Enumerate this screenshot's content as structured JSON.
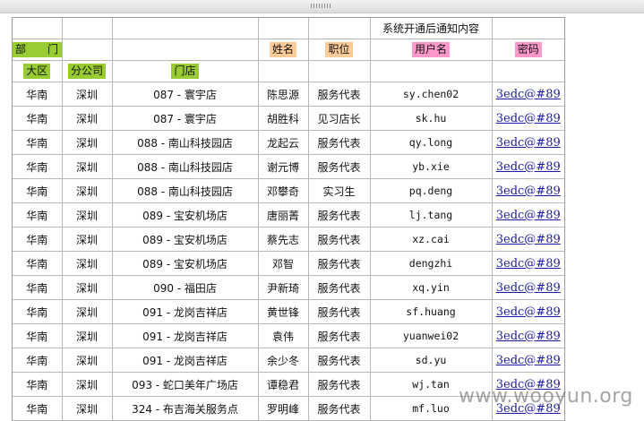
{
  "header": {
    "notify_title": "系统开通后通知内容",
    "dept": "部　门",
    "name": "姓名",
    "position": "职位",
    "username": "用户名",
    "password": "密码",
    "region": "大区",
    "branch": "分公司",
    "store": "门店"
  },
  "colors": {
    "green_highlight": "#99cc33",
    "orange_highlight": "#ffcc99",
    "pink_highlight": "#ff99cc",
    "link": "#1a1aa6"
  },
  "rows": [
    {
      "region": "华南",
      "branch": "深圳",
      "store": "087 - 寰宇店",
      "name": "陈思源",
      "position": "服务代表",
      "username": "sy.chen02",
      "password": "3edc@#89"
    },
    {
      "region": "华南",
      "branch": "深圳",
      "store": "087 - 寰宇店",
      "name": "胡胜科",
      "position": "见习店长",
      "username": "sk.hu",
      "password": "3edc@#89"
    },
    {
      "region": "华南",
      "branch": "深圳",
      "store": "088 - 南山科技园店",
      "name": "龙起云",
      "position": "服务代表",
      "username": "qy.long",
      "password": "3edc@#89"
    },
    {
      "region": "华南",
      "branch": "深圳",
      "store": "088 - 南山科技园店",
      "name": "谢元博",
      "position": "服务代表",
      "username": "yb.xie",
      "password": "3edc@#89"
    },
    {
      "region": "华南",
      "branch": "深圳",
      "store": "088 - 南山科技园店",
      "name": "邓攀奇",
      "position": "实习生",
      "username": "pq.deng",
      "password": "3edc@#89"
    },
    {
      "region": "华南",
      "branch": "深圳",
      "store": "089 - 宝安机场店",
      "name": "唐丽菁",
      "position": "服务代表",
      "username": "lj.tang",
      "password": "3edc@#89"
    },
    {
      "region": "华南",
      "branch": "深圳",
      "store": "089 - 宝安机场店",
      "name": "蔡先志",
      "position": "服务代表",
      "username": "xz.cai",
      "password": "3edc@#89"
    },
    {
      "region": "华南",
      "branch": "深圳",
      "store": "089 - 宝安机场店",
      "name": "邓智",
      "position": "服务代表",
      "username": "dengzhi",
      "password": "3edc@#89"
    },
    {
      "region": "华南",
      "branch": "深圳",
      "store": "090 - 福田店",
      "name": "尹新琦",
      "position": "服务代表",
      "username": "xq.yin",
      "password": "3edc@#89"
    },
    {
      "region": "华南",
      "branch": "深圳",
      "store": "091 - 龙岗吉祥店",
      "name": "黄世锋",
      "position": "服务代表",
      "username": "sf.huang",
      "password": "3edc@#89"
    },
    {
      "region": "华南",
      "branch": "深圳",
      "store": "091 - 龙岗吉祥店",
      "name": "袁伟",
      "position": "服务代表",
      "username": "yuanwei02",
      "password": "3edc@#89"
    },
    {
      "region": "华南",
      "branch": "深圳",
      "store": "091 - 龙岗吉祥店",
      "name": "余少冬",
      "position": "服务代表",
      "username": "sd.yu",
      "password": "3edc@#89"
    },
    {
      "region": "华南",
      "branch": "深圳",
      "store": "093 - 蛇口美年广场店",
      "name": "谭稳君",
      "position": "服务代表",
      "username": "wj.tan",
      "password": "3edc@#89"
    },
    {
      "region": "华南",
      "branch": "深圳",
      "store": "324 - 布吉海关服务点",
      "name": "罗明峰",
      "position": "服务代表",
      "username": "mf.luo",
      "password": "3edc@#89"
    }
  ],
  "watermark": "www.wooyun.org"
}
